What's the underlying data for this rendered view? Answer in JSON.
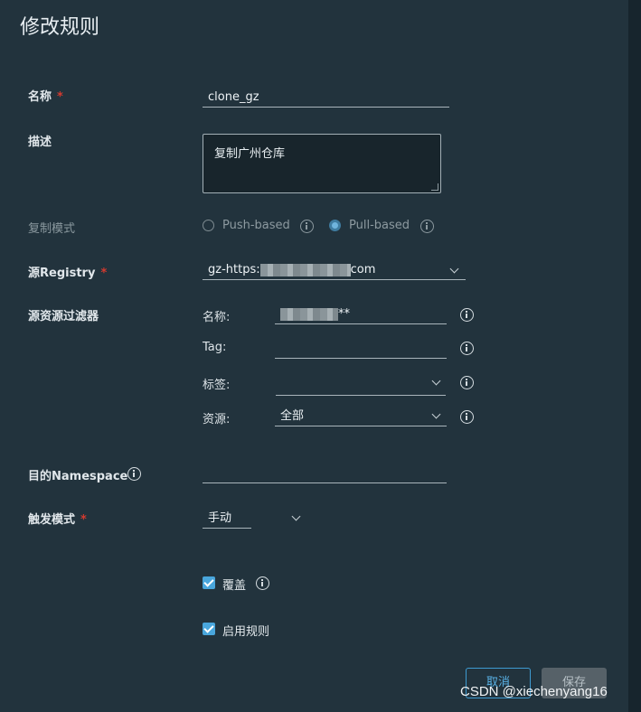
{
  "dialog": {
    "title": "修改规则"
  },
  "form": {
    "name": {
      "label": "名称",
      "required_mark": "*",
      "value": "clone_gz"
    },
    "description": {
      "label": "描述",
      "value": "复制广州仓库"
    },
    "replication_mode": {
      "label": "复制模式",
      "options": [
        {
          "label": "Push-based",
          "selected": false
        },
        {
          "label": "Pull-based",
          "selected": true
        }
      ]
    },
    "source_registry": {
      "label": "源Registry",
      "required_mark": "*",
      "value_prefix": "gz-https:",
      "value_suffix": "com"
    },
    "source_filter": {
      "label": "源资源过滤器",
      "name_label": "名称:",
      "name_value_suffix": "**",
      "tag_label": "Tag:",
      "tag_value": "",
      "labels_label": "标签:",
      "labels_value": "",
      "resource_label": "资源:",
      "resource_value": "全部"
    },
    "dest_namespace": {
      "label": "目的Namespace",
      "value": ""
    },
    "trigger_mode": {
      "label": "触发模式",
      "required_mark": "*",
      "value": "手动"
    },
    "override": {
      "label": "覆盖",
      "checked": true
    },
    "enable_rule": {
      "label": "启用规则",
      "checked": true
    }
  },
  "buttons": {
    "cancel": "取消",
    "save": "保存"
  },
  "watermark": "CSDN @xiechenyang16",
  "icons": [
    "info-icon",
    "chevron-down-icon",
    "checkbox-checked-icon",
    "radio-icon"
  ]
}
